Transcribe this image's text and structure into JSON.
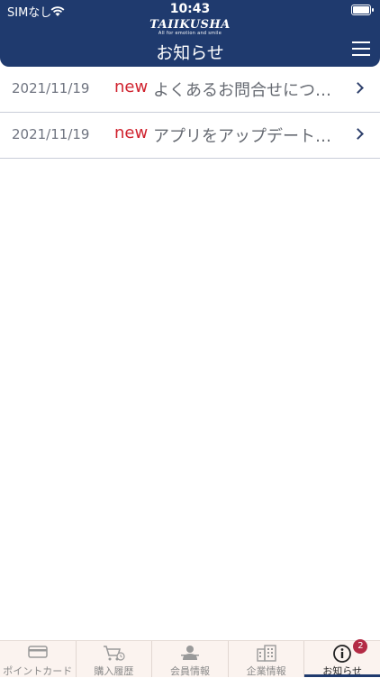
{
  "status_bar": {
    "carrier": "SIMなし",
    "time": "10:43"
  },
  "header": {
    "logo_text": "TAIIKUSHA",
    "logo_tagline": "All for emotion and smile",
    "title": "お知らせ"
  },
  "news": [
    {
      "date": "2021/11/19",
      "badge": "new",
      "title": "よくあるお問合せにつ…"
    },
    {
      "date": "2021/11/19",
      "badge": "new",
      "title": "アプリをアップデート…"
    }
  ],
  "tabs": [
    {
      "label": "ポイントカード",
      "icon": "point-card-icon"
    },
    {
      "label": "購入履歴",
      "icon": "cart-clock-icon"
    },
    {
      "label": "会員情報",
      "icon": "member-icon"
    },
    {
      "label": "企業情報",
      "icon": "building-icon"
    },
    {
      "label": "お知らせ",
      "icon": "info-icon",
      "badge": "2"
    }
  ],
  "colors": {
    "header": "#1f3a6e",
    "new": "#d0232f",
    "badge": "#b32b45",
    "tabbar": "#fbf3ef"
  }
}
